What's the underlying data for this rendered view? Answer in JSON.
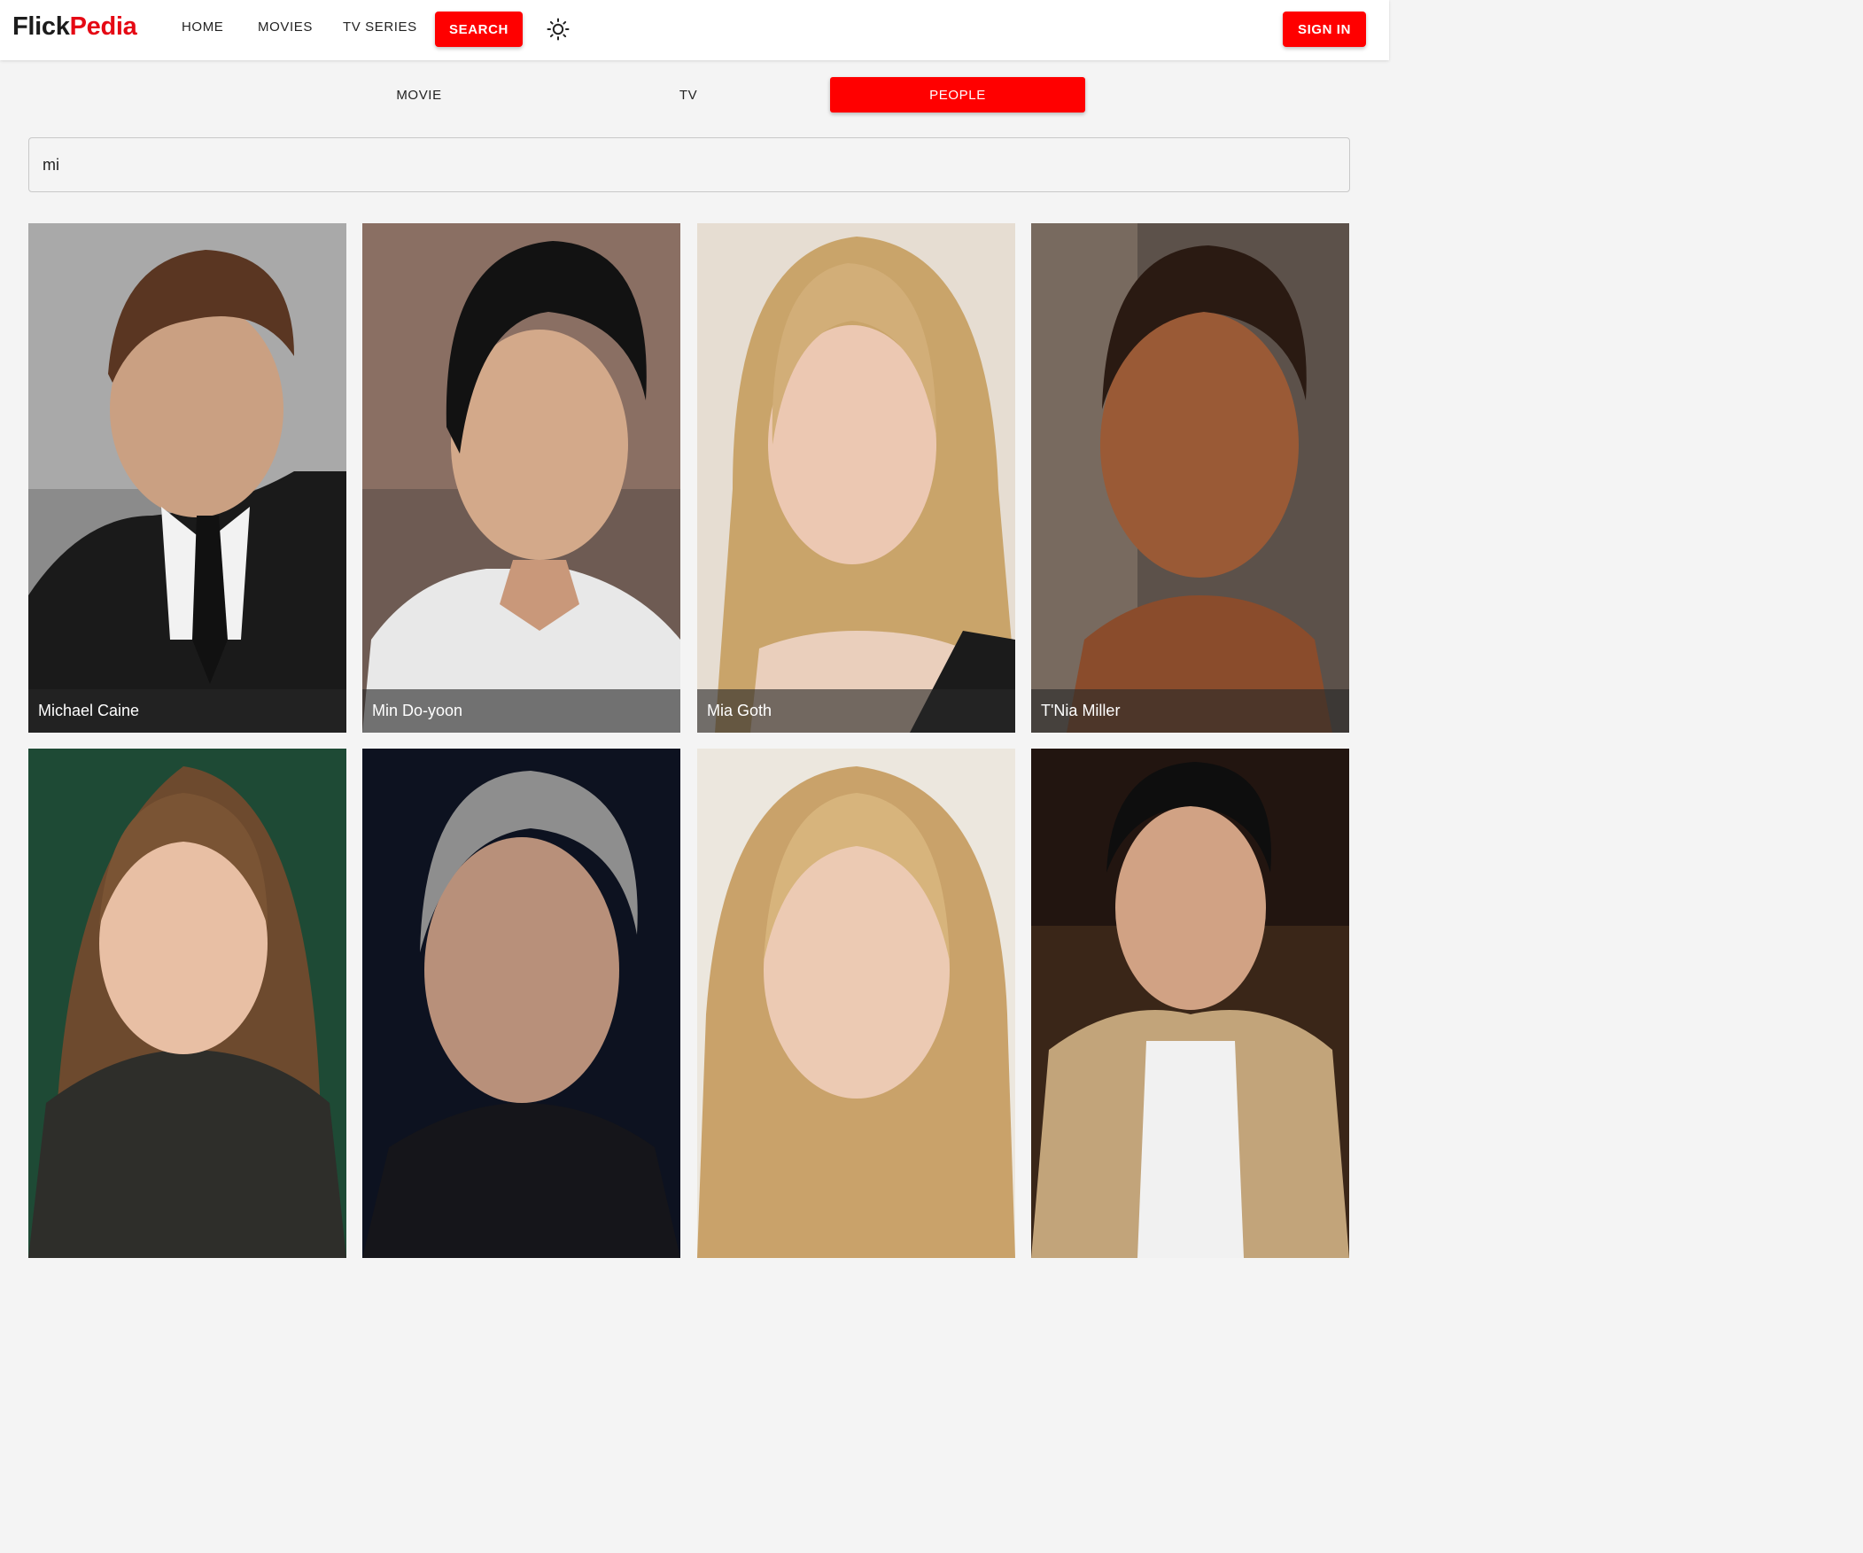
{
  "brand": {
    "part1": "Flick",
    "part2": "Pedia"
  },
  "nav": {
    "home": "HOME",
    "movies": "MOVIES",
    "tv_series": "TV SERIES",
    "search": "SEARCH",
    "theme_icon": "sun-icon",
    "sign_in": "SIGN IN"
  },
  "tabs": [
    {
      "label": "MOVIE",
      "active": false
    },
    {
      "label": "TV",
      "active": false
    },
    {
      "label": "PEOPLE",
      "active": true
    }
  ],
  "search": {
    "value": "mi"
  },
  "people": [
    {
      "name": "Michael Caine"
    },
    {
      "name": "Min Do-yoon"
    },
    {
      "name": "Mia Goth"
    },
    {
      "name": "T'Nia Miller"
    },
    {
      "name": ""
    },
    {
      "name": ""
    },
    {
      "name": ""
    },
    {
      "name": ""
    }
  ],
  "colors": {
    "accent": "#ff0000",
    "brand_dark": "#1c1c1c",
    "background": "#f4f4f4"
  }
}
